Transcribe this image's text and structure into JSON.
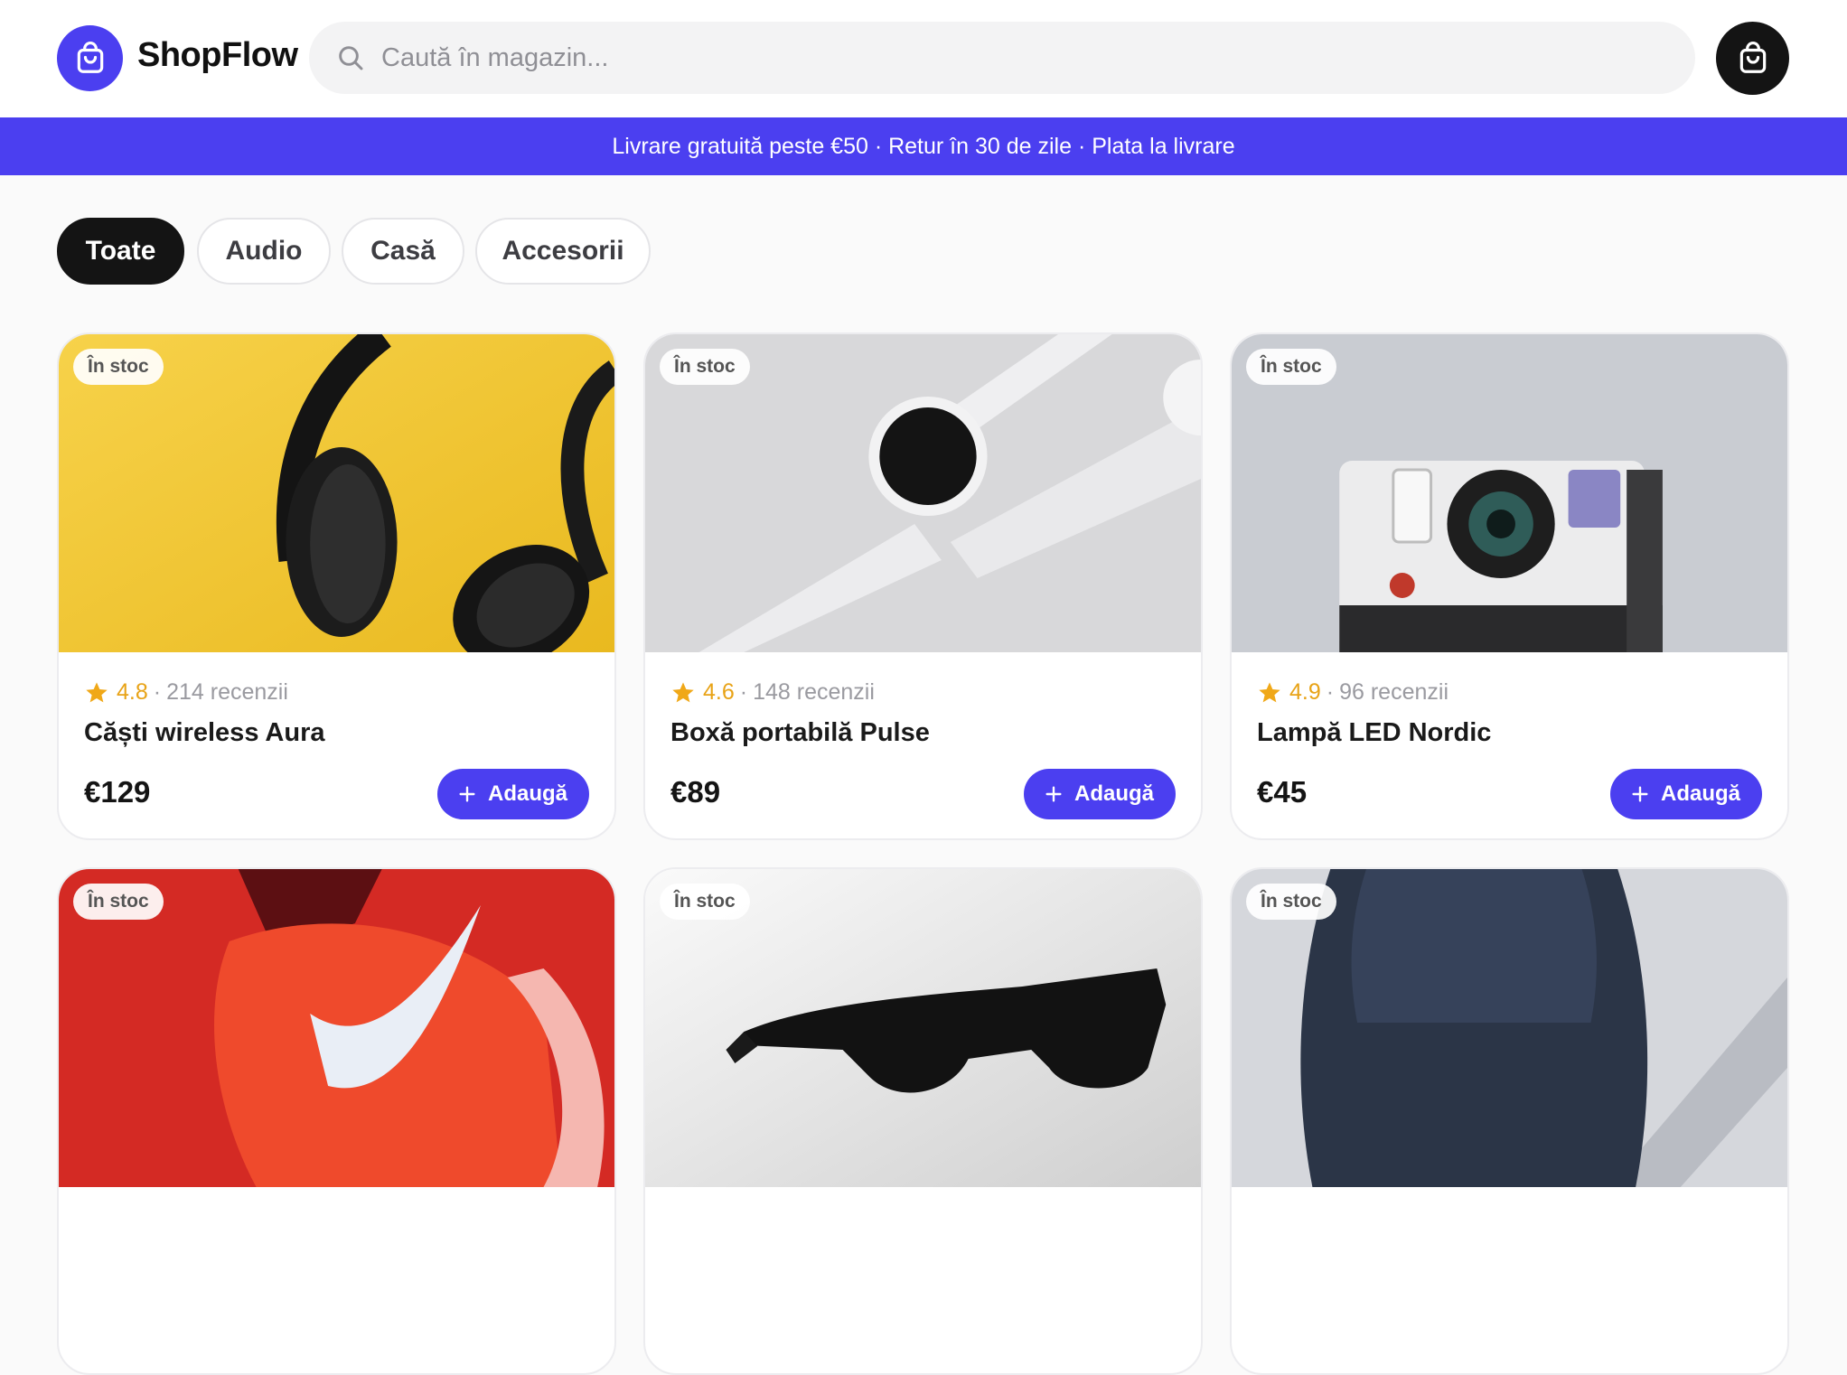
{
  "header": {
    "brand": "ShopFlow",
    "search_placeholder": "Caută în magazin...",
    "accent_color": "#4b3ff0"
  },
  "banner": {
    "text": "Livrare gratuită peste €50 · Retur în 30 de zile · Plata la livrare"
  },
  "filters": [
    {
      "label": "Toate",
      "active": true
    },
    {
      "label": "Audio",
      "active": false
    },
    {
      "label": "Casă",
      "active": false
    },
    {
      "label": "Accesorii",
      "active": false
    }
  ],
  "products": [
    {
      "badge": "În stoc",
      "rating": "4.8",
      "reviews": "214 recenzii",
      "name": "Căști wireless Aura",
      "price": "€129",
      "add_label": "Adaugă",
      "image": "headphones-photo"
    },
    {
      "badge": "În stoc",
      "rating": "4.6",
      "reviews": "148 recenzii",
      "name": "Boxă portabilă Pulse",
      "price": "€89",
      "add_label": "Adaugă",
      "image": "smartwatch-photo"
    },
    {
      "badge": "În stoc",
      "rating": "4.9",
      "reviews": "96 recenzii",
      "name": "Lampă LED Nordic",
      "price": "€45",
      "add_label": "Adaugă",
      "image": "instant-camera-photo"
    },
    {
      "badge": "În stoc",
      "image": "sneaker-photo"
    },
    {
      "badge": "În stoc",
      "image": "sunglasses-photo"
    },
    {
      "badge": "În stoc",
      "image": "backpack-photo"
    }
  ]
}
